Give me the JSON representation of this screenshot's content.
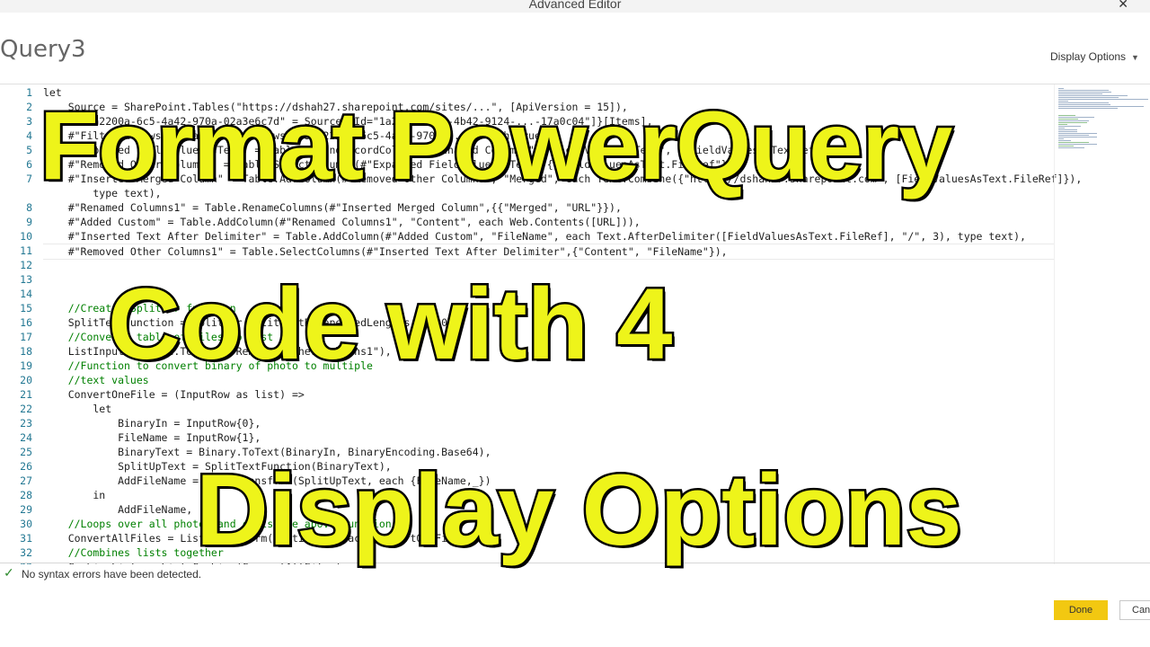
{
  "window": {
    "title": "Advanced Editor",
    "close_glyph": "✕"
  },
  "query": {
    "name": "Query3"
  },
  "display_options": {
    "label": "Display Options",
    "caret": "▼"
  },
  "editor": {
    "lines": [
      {
        "n": "1",
        "text": "let"
      },
      {
        "n": "2",
        "text": "    Source = SharePoint.Tables(\"https://dshah27.sharepoint.com/sites/...\", [ApiVersion = 15]),"
      },
      {
        "n": "3",
        "text": "    #\"55a2200a-6c5-4a42-970a-02a3e6c7d\" = Source{[Id=\"1a22fd5-...-4b42-9124-...-17a0c04\"]}[Items],"
      },
      {
        "n": "4",
        "text": "    #\"Filtered Rows\" = Table.SelectRows(#\"55a2200a-6c5-4a42-970a-...\", each true),"
      },
      {
        "n": "5",
        "text": "    #\"Expanded FieldValuesAsText\" = Table.ExpandRecordColumn(#\"Renamed Columns\", \"FieldValuesAsText\", {\"FieldValuesAsTextRef\"}),"
      },
      {
        "n": "6",
        "text": "    #\"Removed Other Columns\" = Table.SelectColumns(#\"Expanded FieldValuesAsText\",{\"FieldValuesAsText.FileRef\"}),"
      },
      {
        "n": "7",
        "text": "    #\"Inserted Merged Column\" = Table.AddColumn(#\"Removed Other Columns\", \"Merged\", each Text.Combine({\"https://dshah27.sharepoint.com\", [FieldValuesAsText.FileRef]}), "
      },
      {
        "n": "",
        "text": "        type text),"
      },
      {
        "n": "8",
        "text": "    #\"Renamed Columns1\" = Table.RenameColumns(#\"Inserted Merged Column\",{{\"Merged\", \"URL\"}}),"
      },
      {
        "n": "9",
        "text": "    #\"Added Custom\" = Table.AddColumn(#\"Renamed Columns1\", \"Content\", each Web.Contents([URL])),"
      },
      {
        "n": "10",
        "text": "    #\"Inserted Text After Delimiter\" = Table.AddColumn(#\"Added Custom\", \"FileName\", each Text.AfterDelimiter([FieldValuesAsText.FileRef], \"/\", 3), type text),"
      },
      {
        "n": "11",
        "text": "    #\"Removed Other Columns1\" = Table.SelectColumns(#\"Inserted Text After Delimiter\",{\"Content\", \"FileName\"}),",
        "current": true
      },
      {
        "n": "12",
        "text": ""
      },
      {
        "n": "13",
        "text": ""
      },
      {
        "n": "14",
        "text": "    "
      },
      {
        "n": "15",
        "text": "    //Creates Splitter function",
        "comment": true
      },
      {
        "n": "16",
        "text": "    SplitTextFunction = Splitter.SplitTextByRepeatedLengths(30000),"
      },
      {
        "n": "17",
        "text": "    //Converts table of files to list",
        "comment": true
      },
      {
        "n": "18",
        "text": "    ListInput = Table.ToRows(#\"Removed Other Columns1\"),"
      },
      {
        "n": "19",
        "text": "    //Function to convert binary of photo to multiple",
        "comment": true
      },
      {
        "n": "20",
        "text": "    //text values",
        "comment": true
      },
      {
        "n": "21",
        "text": "    ConvertOneFile = (InputRow as list) =>"
      },
      {
        "n": "22",
        "text": "        let"
      },
      {
        "n": "23",
        "text": "            BinaryIn = InputRow{0},"
      },
      {
        "n": "24",
        "text": "            FileName = InputRow{1},"
      },
      {
        "n": "25",
        "text": "            BinaryText = Binary.ToText(BinaryIn, BinaryEncoding.Base64),"
      },
      {
        "n": "26",
        "text": "            SplitUpText = SplitTextFunction(BinaryText),"
      },
      {
        "n": "27",
        "text": "            AddFileName = List.Transform(SplitUpText, each {FileName,_})"
      },
      {
        "n": "28",
        "text": "        in"
      },
      {
        "n": "29",
        "text": "            AddFileName,"
      },
      {
        "n": "30",
        "text": "    //Loops over all photos and calls the above function",
        "comment": true
      },
      {
        "n": "31",
        "text": "    ConvertAllFiles = List.Transform(ListInput, each ConvertOneFile(_)),"
      },
      {
        "n": "32",
        "text": "    //Combines lists together",
        "comment": true
      },
      {
        "n": "33",
        "text": "    CombineLists = List.Combine(ConvertAllFiles),"
      }
    ]
  },
  "status": {
    "icon": "✓",
    "message": "No syntax errors have been detected."
  },
  "buttons": {
    "done": "Done",
    "cancel": "Cancel"
  },
  "overlay": {
    "line1": "Format PowerQuery",
    "line2": "Code with 4",
    "line3": "Display Options"
  },
  "colors": {
    "accent": "#f2c811",
    "overlay_text": "#eef41a",
    "comment": "#008000",
    "line_number": "#237893"
  }
}
